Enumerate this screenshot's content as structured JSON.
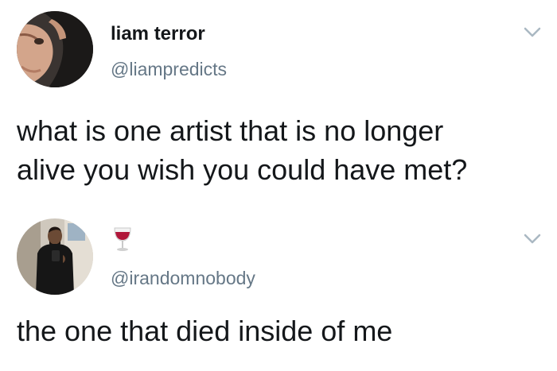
{
  "tweets": [
    {
      "display_name": "liam terror",
      "handle": "@liampredicts",
      "text_lines": [
        "what is one artist that is no longer",
        "alive you wish you could have met?"
      ],
      "avatar_icon": "profile-photo-hooded-face",
      "menu_icon": "chevron-down-icon"
    },
    {
      "display_name_emoji": "wine-glass-emoji",
      "handle": "@irandomnobody",
      "text_lines": [
        "the one that died inside of me"
      ],
      "avatar_icon": "profile-photo-mirror-selfie",
      "menu_icon": "chevron-down-icon"
    }
  ],
  "colors": {
    "text": "#14171a",
    "secondary_text": "#657786",
    "chevron": "#aab8c2",
    "background": "#ffffff"
  }
}
